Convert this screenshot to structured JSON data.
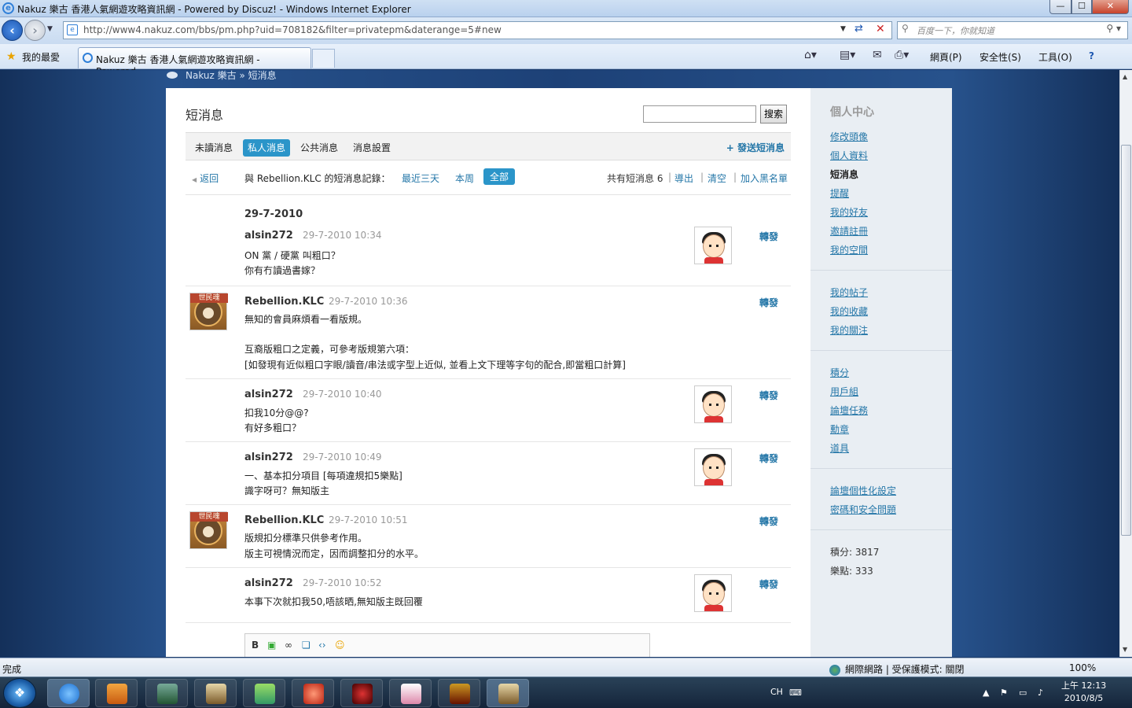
{
  "window": {
    "title": "Nakuz 樂古 香港人氣網遊攻略資訊網 - Powered by Discuz! - Windows Internet Explorer",
    "min": "—",
    "max": "☐",
    "close": "✕"
  },
  "browser": {
    "url": "http://www4.nakuz.com/bbs/pm.php?uid=708182&filter=privatepm&daterange=5#new",
    "search_placeholder": "百度一下，你就知道",
    "favorites": "我的最愛",
    "tab_title": "Nakuz 樂古 香港人氣網遊攻略資訊網 - Powered...",
    "menu": {
      "page": "網頁(P)",
      "safety": "安全性(S)",
      "tools": "工具(O)",
      "help": "?"
    }
  },
  "breadcrumb": "Nakuz 樂古 » 短消息",
  "pm": {
    "title": "短消息",
    "search_button": "搜索",
    "tabs": [
      "未讀消息",
      "私人消息",
      "公共消息",
      "消息設置"
    ],
    "active_tab": 1,
    "send": "+ 發送短消息",
    "back": "返回",
    "with_text": "與 Rebellion.KLC 的短消息記錄：",
    "filters": {
      "three_days": "最近三天",
      "week": "本周",
      "all": "全部"
    },
    "total": "共有短消息 6",
    "export": "導出",
    "clear": "清空",
    "blacklist": "加入黑名單",
    "date_header": "29-7-2010",
    "forward": "轉發",
    "messages": [
      {
        "user": "alsin272",
        "time": "29-7-2010 10:34",
        "lines": [
          "ON 黨 / 硬黨 叫粗口？",
          "你有冇讀過書嫁？"
        ]
      },
      {
        "user": "Rebellion.KLC",
        "time": "29-7-2010 10:36",
        "lines": [
          "無知的會員麻煩看一看版規。",
          "",
          "互裔版粗口之定義，可參考版規第六項：",
          "[如發現有近似粗口字眼/讀音/串法或字型上近似, 並看上文下理等字句的配合,即當粗口計算]"
        ]
      },
      {
        "user": "alsin272",
        "time": "29-7-2010 10:40",
        "lines": [
          "扣我10分@@?",
          "有好多粗口？"
        ]
      },
      {
        "user": "alsin272",
        "time": "29-7-2010 10:49",
        "lines": [
          "一、基本扣分項目 [每項違規扣5樂點]",
          "識字呀可？無知版主"
        ]
      },
      {
        "user": "Rebellion.KLC",
        "time": "29-7-2010 10:51",
        "lines": [
          "版規扣分標準只供參考作用。",
          "版主可視情況而定，因而調整扣分的水平。"
        ]
      },
      {
        "user": "alsin272",
        "time": "29-7-2010 10:52",
        "lines": [
          "本事下次就扣我50,唔該晒,無知版主既回覆"
        ]
      }
    ],
    "avatar_banner": "世民魂"
  },
  "sidebar": {
    "heading": "個人中心",
    "group1": [
      "修改頭像",
      "個人資料",
      "短消息",
      "提醒",
      "我的好友",
      "邀請註冊",
      "我的空間"
    ],
    "group2": [
      "我的帖子",
      "我的收藏",
      "我的關注"
    ],
    "group3": [
      "積分",
      "用戶組",
      "論壇任務",
      "勳章",
      "道具"
    ],
    "group4": [
      "論壇個性化設定",
      "密碼和安全問題"
    ],
    "stats": [
      "積分: 3817",
      "樂點: 333"
    ]
  },
  "statusbar": {
    "text": "完成",
    "zone": "網際網路 | 受保護模式: 關閉",
    "zoom": "100%"
  },
  "taskbar": {
    "lang": "CH",
    "time": "上午 12:13",
    "date": "2010/8/5"
  }
}
